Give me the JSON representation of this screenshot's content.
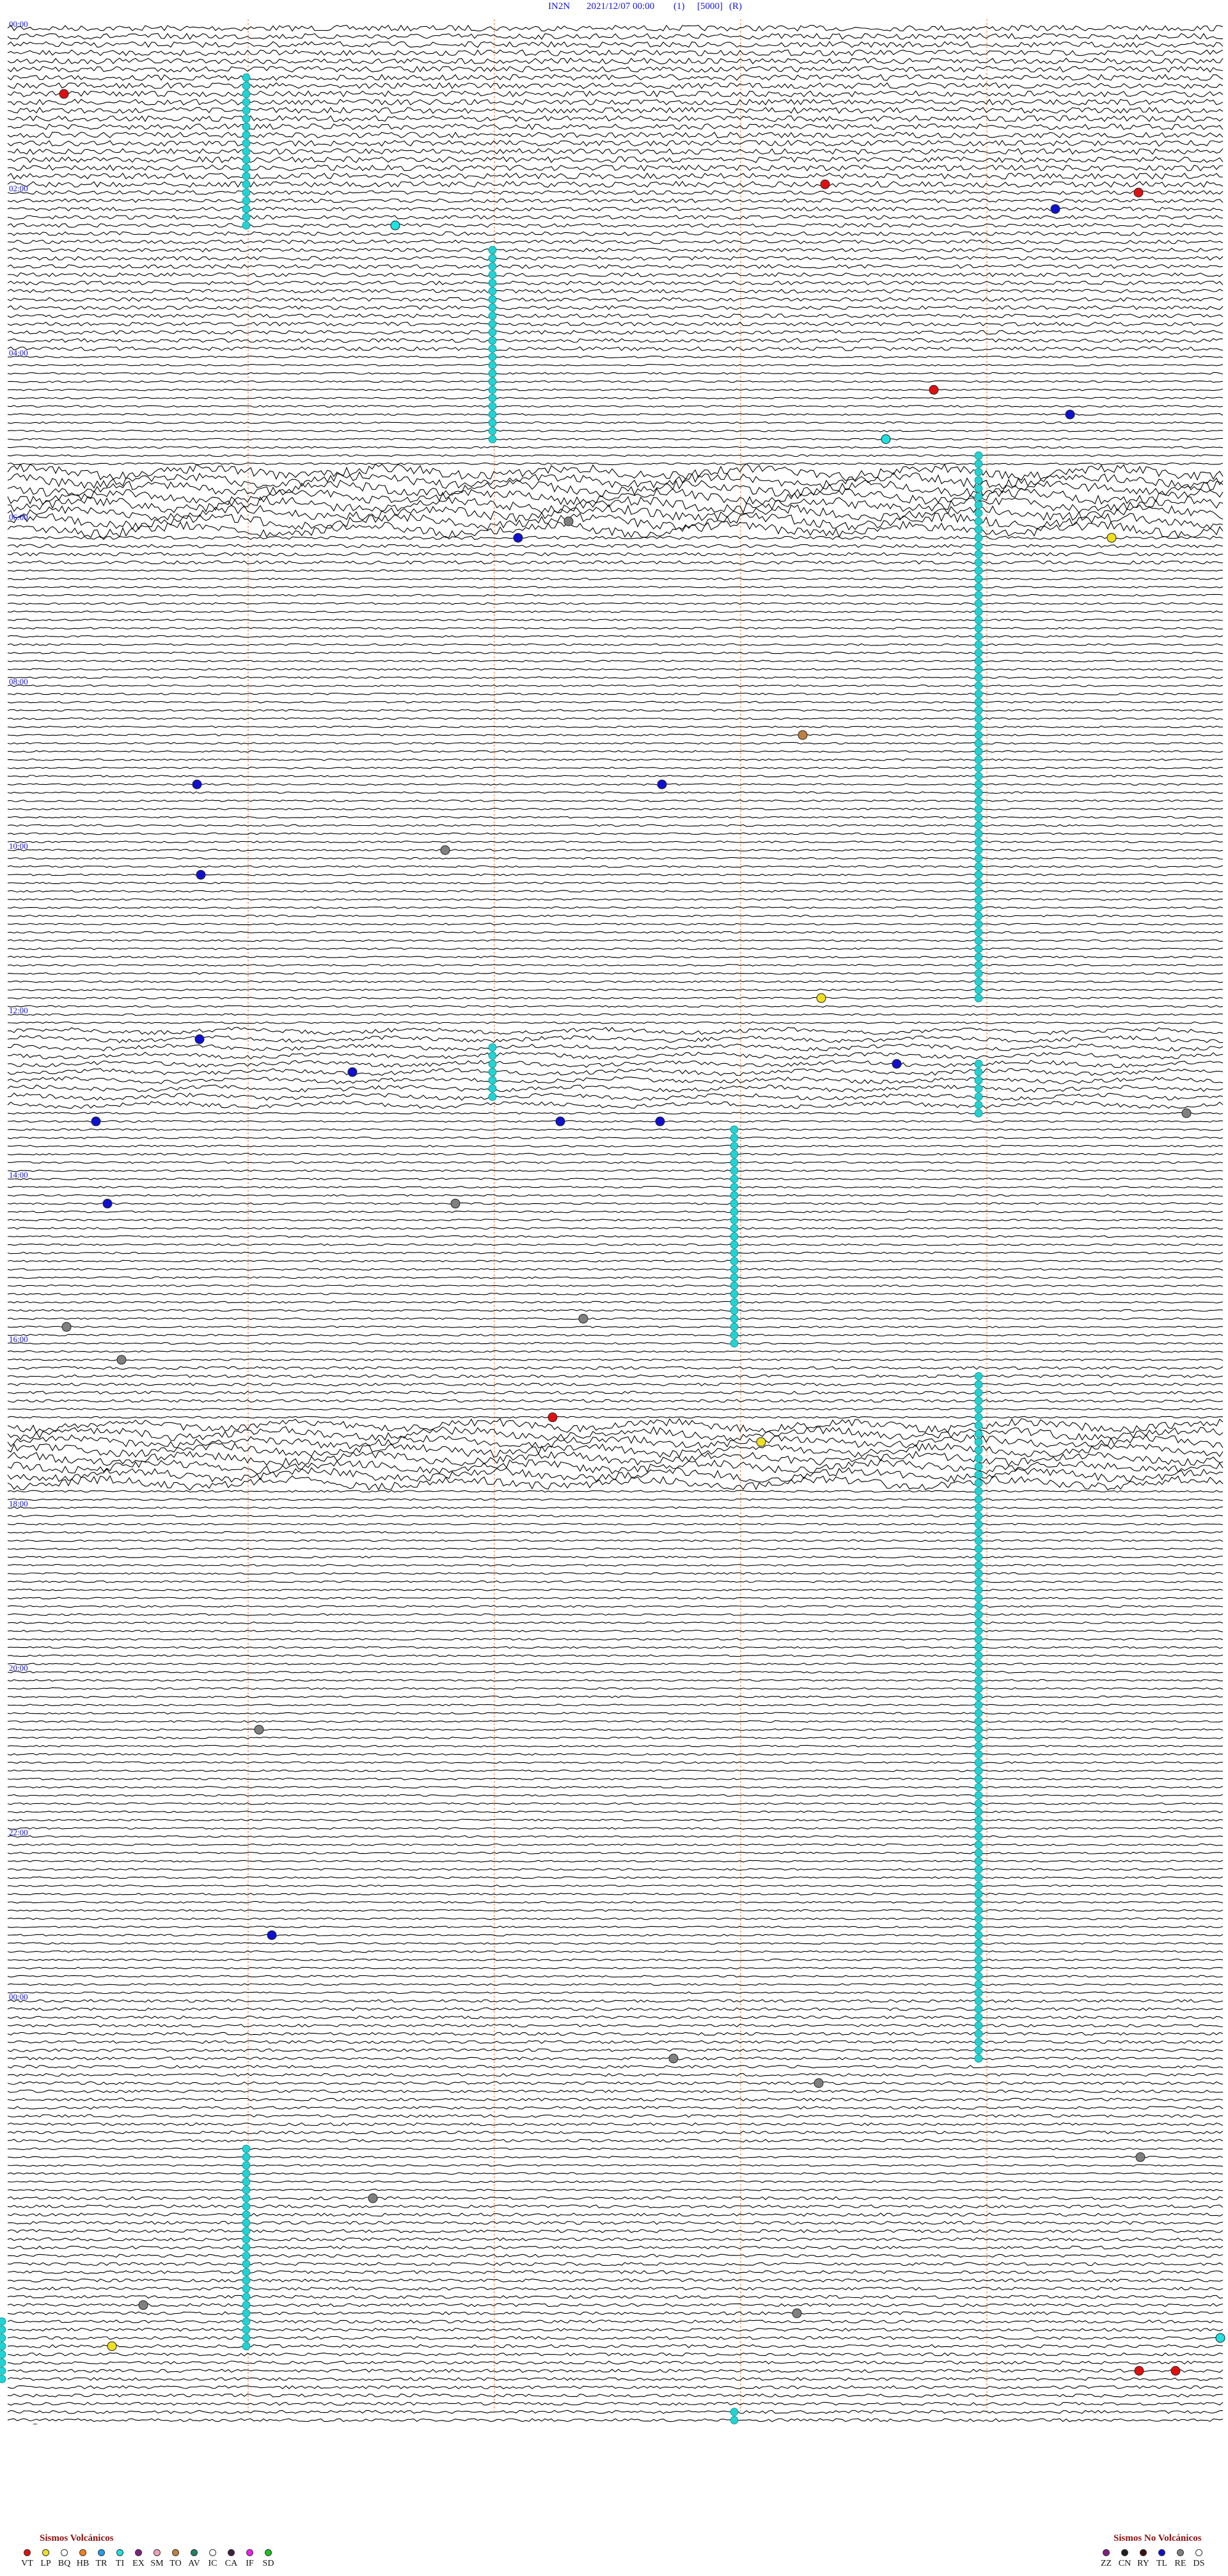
{
  "header": {
    "station": "IN2N",
    "datetime": "2021/12/07 00:00",
    "channel": "(1)",
    "gain": "[5000]",
    "mode": "(R)"
  },
  "colors": {
    "trace": "#000000",
    "time_label": "#1515d8",
    "minute_marker": "#f0a070",
    "bar": "#22d3d3"
  },
  "hours": [
    {
      "hour": 0,
      "label": "00:00"
    },
    {
      "hour": 2,
      "label": "02:00"
    },
    {
      "hour": 4,
      "label": "04:00"
    },
    {
      "hour": 6,
      "label": "06:00"
    },
    {
      "hour": 8,
      "label": "08:00"
    },
    {
      "hour": 10,
      "label": "10:00"
    },
    {
      "hour": 12,
      "label": "12:00"
    },
    {
      "hour": 14,
      "label": "14:00"
    },
    {
      "hour": 16,
      "label": "16:00"
    },
    {
      "hour": 18,
      "label": "18:00"
    },
    {
      "hour": 20,
      "label": "20:00"
    },
    {
      "hour": 22,
      "label": "22:00"
    },
    {
      "hour": 24,
      "label": "00:00"
    }
  ],
  "legend_volcanic": {
    "title": "Sismos Volcánicos",
    "items": [
      {
        "code": "VT",
        "color": "#e01010"
      },
      {
        "code": "LP",
        "color": "#f0e020"
      },
      {
        "code": "BQ",
        "color": "#ffffff"
      },
      {
        "code": "HB",
        "color": "#f08020"
      },
      {
        "code": "TR",
        "color": "#20a0f0"
      },
      {
        "code": "TI",
        "color": "#20e0e0"
      },
      {
        "code": "EX",
        "color": "#802080"
      },
      {
        "code": "SM",
        "color": "#f0a0c0"
      },
      {
        "code": "TO",
        "color": "#c08040"
      },
      {
        "code": "AV",
        "color": "#208060"
      },
      {
        "code": "IC",
        "color": "#ffffff"
      },
      {
        "code": "CA",
        "color": "#402040"
      },
      {
        "code": "IF",
        "color": "#f020f0"
      },
      {
        "code": "SD",
        "color": "#20c020"
      }
    ]
  },
  "legend_nonvolcanic": {
    "title": "Sismos No Volcánicos",
    "items": [
      {
        "code": "ZZ",
        "color": "#802080"
      },
      {
        "code": "CN",
        "color": "#202020"
      },
      {
        "code": "RY",
        "color": "#401010"
      },
      {
        "code": "TL",
        "color": "#1010d0"
      },
      {
        "code": "RE",
        "color": "#808080"
      },
      {
        "code": "DS",
        "color": "#ffffff"
      }
    ]
  }
}
